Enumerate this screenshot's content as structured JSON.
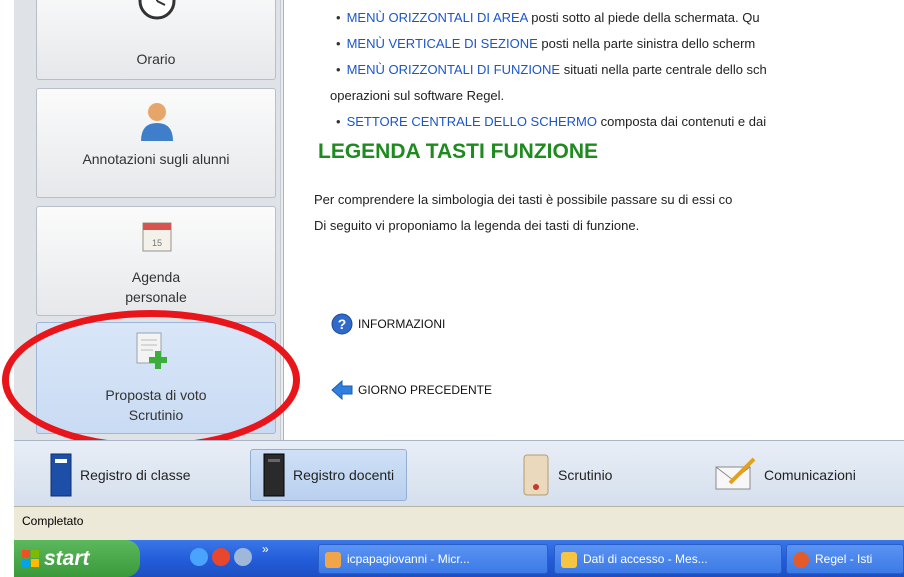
{
  "sidebar": {
    "items": [
      {
        "label": "Orario",
        "icon": "clock-icon"
      },
      {
        "label": "Annotazioni sugli alunni",
        "icon": "person-icon"
      },
      {
        "label": "Agenda",
        "sublabel": "personale",
        "icon": "calendar-icon",
        "calendar_day": "15"
      },
      {
        "label": "Proposta di voto",
        "sublabel": "Scrutinio",
        "icon": "document-plus-icon"
      }
    ]
  },
  "main": {
    "bullets": [
      {
        "key": "MENÙ ORIZZONTALI DI AREA",
        "rest": " posti sotto al piede della schermata. Qu"
      },
      {
        "key": "MENÙ VERTICALE DI SEZIONE",
        "rest": " posti nella parte sinistra dello scherm"
      },
      {
        "key": "MENÙ ORIZZONTALI DI FUNZIONE",
        "rest": " situati nella parte centrale dello sch"
      }
    ],
    "continuation": "operazioni sul software Regel.",
    "bullet4": {
      "key": "SETTORE CENTRALE DELLO SCHERMO",
      "rest": " composta dai contenuti e dai"
    },
    "legend_title": "LEGENDA TASTI FUNZIONE",
    "para1": "Per comprendere la simbologia dei tasti è possibile passare su di essi co",
    "para2": "Di seguito vi proponiamo la legenda dei tasti di funzione.",
    "info_label": "INFORMAZIONI",
    "prev_day_label": "GIORNO PRECEDENTE"
  },
  "bottom_nav": {
    "tabs": [
      {
        "label": "Registro di classe"
      },
      {
        "label": "Registro docenti"
      },
      {
        "label": "Scrutinio"
      },
      {
        "label": "Comunicazioni"
      }
    ]
  },
  "status_bar": {
    "text": "Completato"
  },
  "taskbar": {
    "start_label": "start",
    "items": [
      {
        "label": "icpapagiovanni - Micr..."
      },
      {
        "label": "Dati di accesso - Mes..."
      },
      {
        "label": "Regel - Isti"
      }
    ]
  },
  "colors": {
    "highlight_ellipse": "#e8161b",
    "legend_title": "#1f8a1f",
    "link_blue": "#1a56c8"
  }
}
